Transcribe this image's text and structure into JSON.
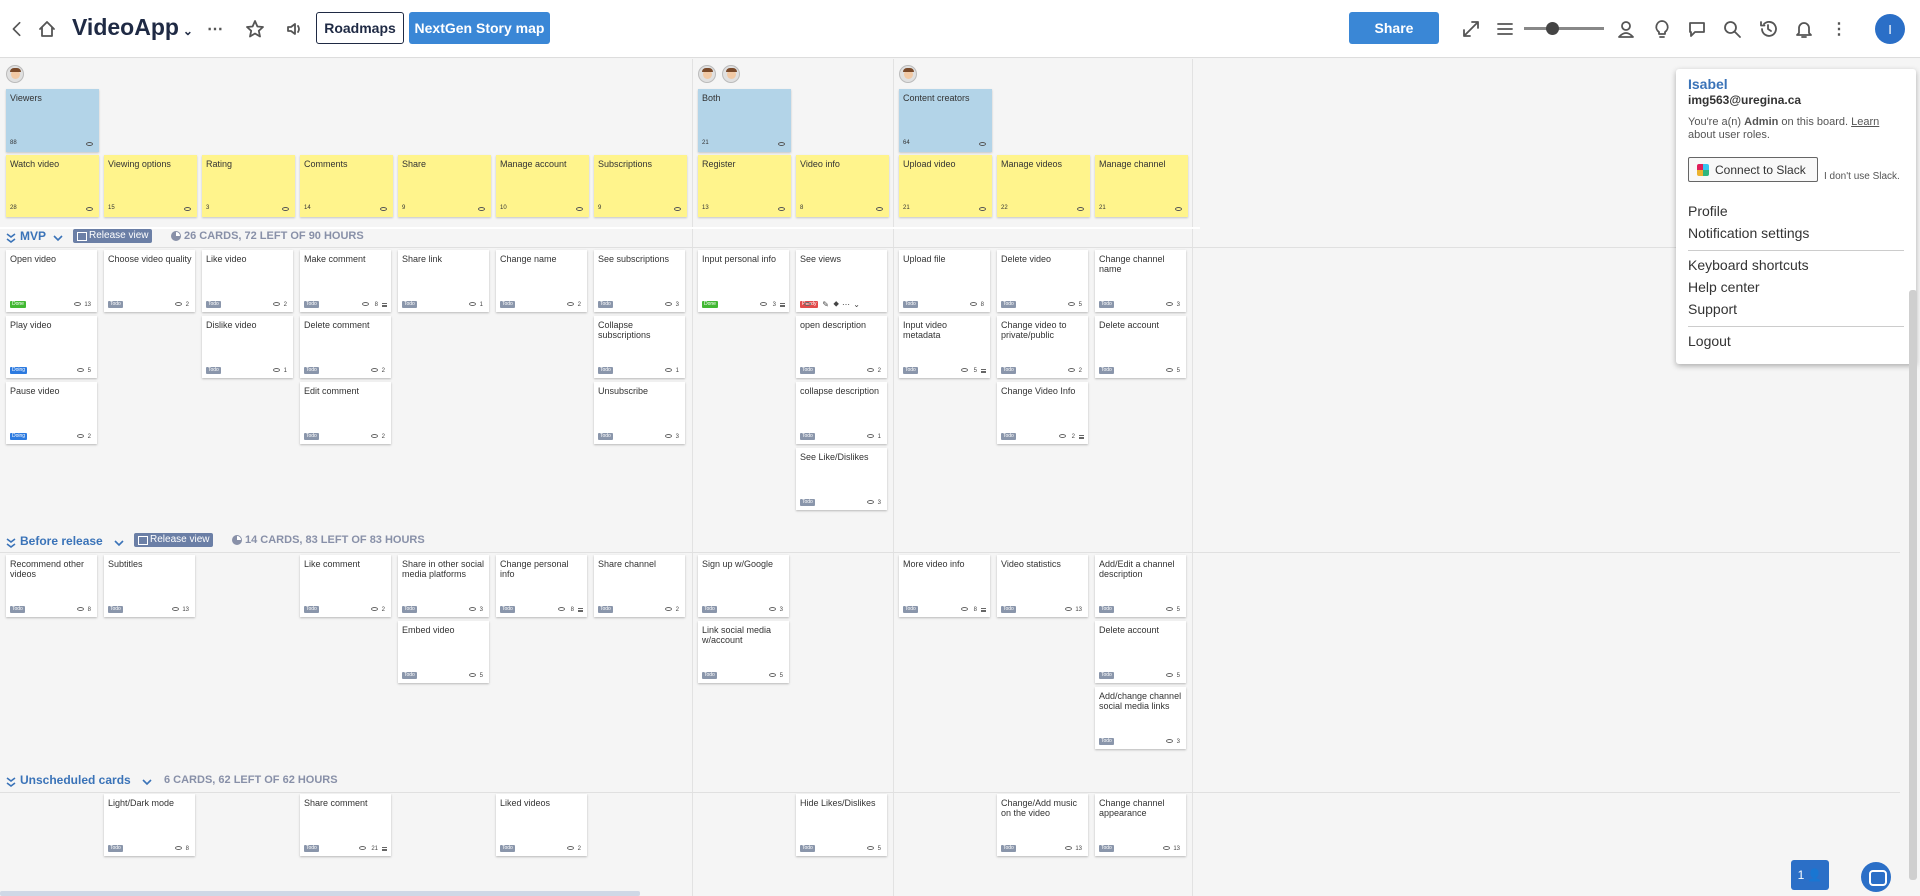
{
  "topbar": {
    "app_title": "VideoApp",
    "roadmaps_label": "Roadmaps",
    "nextgen_label": "NextGen Story map",
    "share_label": "Share",
    "zoom_level": 0.35,
    "avatar_initial": "I"
  },
  "personas": [
    {
      "name": "Viewers",
      "count": "88"
    },
    {
      "name": "Both",
      "count": "21"
    },
    {
      "name": "Content creators",
      "count": "64"
    }
  ],
  "activities": [
    {
      "name": "Watch video",
      "count": "28"
    },
    {
      "name": "Viewing options",
      "count": "15"
    },
    {
      "name": "Rating",
      "count": "3"
    },
    {
      "name": "Comments",
      "count": "14"
    },
    {
      "name": "Share",
      "count": "9"
    },
    {
      "name": "Manage account",
      "count": "10"
    },
    {
      "name": "Subscriptions",
      "count": "9"
    },
    {
      "name": "Register",
      "count": "13"
    },
    {
      "name": "Video info",
      "count": "8"
    },
    {
      "name": "Upload video",
      "count": "21"
    },
    {
      "name": "Manage videos",
      "count": "22"
    },
    {
      "name": "Manage channel",
      "count": "21"
    }
  ],
  "releases": [
    {
      "name": "MVP",
      "view_label": "Release view",
      "stats": "26 CARDS, 72 LEFT OF 90 HOURS"
    },
    {
      "name": "Before release",
      "view_label": "Release view",
      "stats": "14 CARDS, 83 LEFT OF 83 HOURS"
    },
    {
      "name": "Unscheduled cards",
      "stats": "6 CARDS, 62 LEFT OF 62 HOURS"
    }
  ],
  "cards": [
    {
      "title": "Open video",
      "status": "Done",
      "count": "13"
    },
    {
      "title": "Play video",
      "status": "Doing",
      "count": "5"
    },
    {
      "title": "Pause video",
      "status": "Doing",
      "count": "2"
    },
    {
      "title": "Choose video quality",
      "status": "Todo",
      "count": "2"
    },
    {
      "title": "Like video",
      "status": "Todo",
      "count": "2"
    },
    {
      "title": "Dislike video",
      "status": "Todo",
      "count": "1"
    },
    {
      "title": "Make comment",
      "status": "Todo",
      "count": "8"
    },
    {
      "title": "Delete comment",
      "status": "Todo",
      "count": "2"
    },
    {
      "title": "Edit comment",
      "status": "Todo",
      "count": "2"
    },
    {
      "title": "Share link",
      "status": "Todo",
      "count": "1"
    },
    {
      "title": "Change name",
      "status": "Todo",
      "count": "2"
    },
    {
      "title": "See subscriptions",
      "status": "Todo",
      "count": "3"
    },
    {
      "title": "Collapse subscriptions",
      "status": "Todo",
      "count": "1"
    },
    {
      "title": "Unsubscribe",
      "status": "Todo",
      "count": "3"
    },
    {
      "title": "Input personal info",
      "status": "Done",
      "count": "3"
    },
    {
      "title": "See views",
      "status": "Ready",
      "count": ""
    },
    {
      "title": "open description",
      "status": "Todo",
      "count": "2"
    },
    {
      "title": "collapse description",
      "status": "Todo",
      "count": "1"
    },
    {
      "title": "See Like/Dislikes",
      "status": "Todo",
      "count": "3"
    },
    {
      "title": "Upload file",
      "status": "Todo",
      "count": "8"
    },
    {
      "title": "Input video metadata",
      "status": "Todo",
      "count": "5"
    },
    {
      "title": "Delete video",
      "status": "Todo",
      "count": "5"
    },
    {
      "title": "Change video to private/public",
      "status": "Todo",
      "count": "2"
    },
    {
      "title": "Change Video Info",
      "status": "Todo",
      "count": "2"
    },
    {
      "title": "Change channel name",
      "status": "Todo",
      "count": "3"
    },
    {
      "title": "Delete account",
      "status": "Todo",
      "count": "5"
    },
    {
      "title": "Recommend other videos",
      "status": "Todo",
      "count": "8"
    },
    {
      "title": "Subtitles",
      "status": "Todo",
      "count": "13"
    },
    {
      "title": "Like comment",
      "status": "Todo",
      "count": "2"
    },
    {
      "title": "Share in other social media platforms",
      "status": "Todo",
      "count": "3"
    },
    {
      "title": "Embed video",
      "status": "Todo",
      "count": "5"
    },
    {
      "title": "Change personal info",
      "status": "Todo",
      "count": "8"
    },
    {
      "title": "Share channel",
      "status": "Todo",
      "count": "2"
    },
    {
      "title": "Sign up w/Google",
      "status": "Todo",
      "count": "3"
    },
    {
      "title": "Link social media w/account",
      "status": "Todo",
      "count": "5"
    },
    {
      "title": "More video info",
      "status": "Todo",
      "count": "8"
    },
    {
      "title": "Video statistics",
      "status": "Todo",
      "count": "13"
    },
    {
      "title": "Add/Edit a channel description",
      "status": "Todo",
      "count": "5"
    },
    {
      "title": "Delete account",
      "status": "Todo",
      "count": "5"
    },
    {
      "title": "Add/change channel social media links",
      "status": "Todo",
      "count": "3"
    },
    {
      "title": "Light/Dark mode",
      "status": "Todo",
      "count": "8"
    },
    {
      "title": "Share comment",
      "status": "Todo",
      "count": "21"
    },
    {
      "title": "Liked videos",
      "status": "Todo",
      "count": "2"
    },
    {
      "title": "Hide Likes/Dislikes",
      "status": "Todo",
      "count": "5"
    },
    {
      "title": "Change/Add music on the video",
      "status": "Todo",
      "count": "13"
    },
    {
      "title": "Change channel appearance",
      "status": "Todo",
      "count": "13"
    }
  ],
  "user_menu": {
    "name": "Isabel",
    "email": "img563@uregina.ca",
    "role_prefix": "You're a(n)",
    "role": "Admin",
    "role_suffix": "on this board.",
    "learn_link": "Learn",
    "role_about": "about user roles.",
    "slack_button": "Connect to Slack",
    "no_slack": "I don't use Slack.",
    "items": [
      "Profile",
      "Notification settings",
      "Keyboard shortcuts",
      "Help center",
      "Support",
      "Logout"
    ]
  },
  "online_users": "1"
}
